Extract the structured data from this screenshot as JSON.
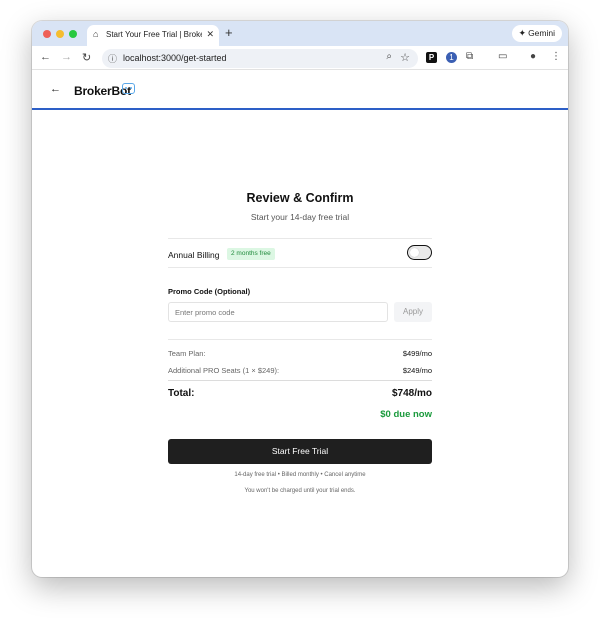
{
  "browser": {
    "tab_title": "Start Your Free Trial | BrokerBot",
    "tab_icon": "house-icon",
    "new_tab_symbol": "+",
    "gemini_label": "Gemini",
    "url": "localhost:3000/get-started",
    "extensions": {
      "p_label": "P",
      "o_label": "1"
    }
  },
  "app": {
    "brand": "BrokerBot",
    "accent_color": "#2d5fc7"
  },
  "checkout": {
    "title": "Review & Confirm",
    "subtitle": "Start your 14-day free trial",
    "billing_label": "Annual Billing",
    "billing_badge": "2 months free",
    "annual_billing_enabled": false,
    "promo_label": "Promo Code (Optional)",
    "promo_placeholder": "Enter promo code",
    "promo_value": "",
    "apply_label": "Apply",
    "lines": [
      {
        "label": "Team Plan:",
        "value": "$499/mo"
      },
      {
        "label": "Additional PRO Seats (1 × $249):",
        "value": "$249/mo"
      }
    ],
    "total_label": "Total:",
    "total_value": "$748/mo",
    "due_now": "$0 due now",
    "cta_label": "Start Free Trial",
    "fine_print_1": "14-day free trial • Billed monthly • Cancel anytime",
    "fine_print_2": "You won't be charged until your trial ends."
  }
}
